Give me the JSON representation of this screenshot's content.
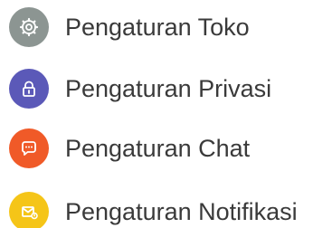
{
  "menu": {
    "items": [
      {
        "label": "Pengaturan Toko",
        "icon": "settings-icon",
        "color": "#8c9592"
      },
      {
        "label": "Pengaturan Privasi",
        "icon": "lock-icon",
        "color": "#5b59b8"
      },
      {
        "label": "Pengaturan Chat",
        "icon": "chat-icon",
        "color": "#f05a28"
      },
      {
        "label": "Pengaturan Notifikasi",
        "icon": "mail-notification-icon",
        "color": "#f5c518"
      }
    ]
  }
}
